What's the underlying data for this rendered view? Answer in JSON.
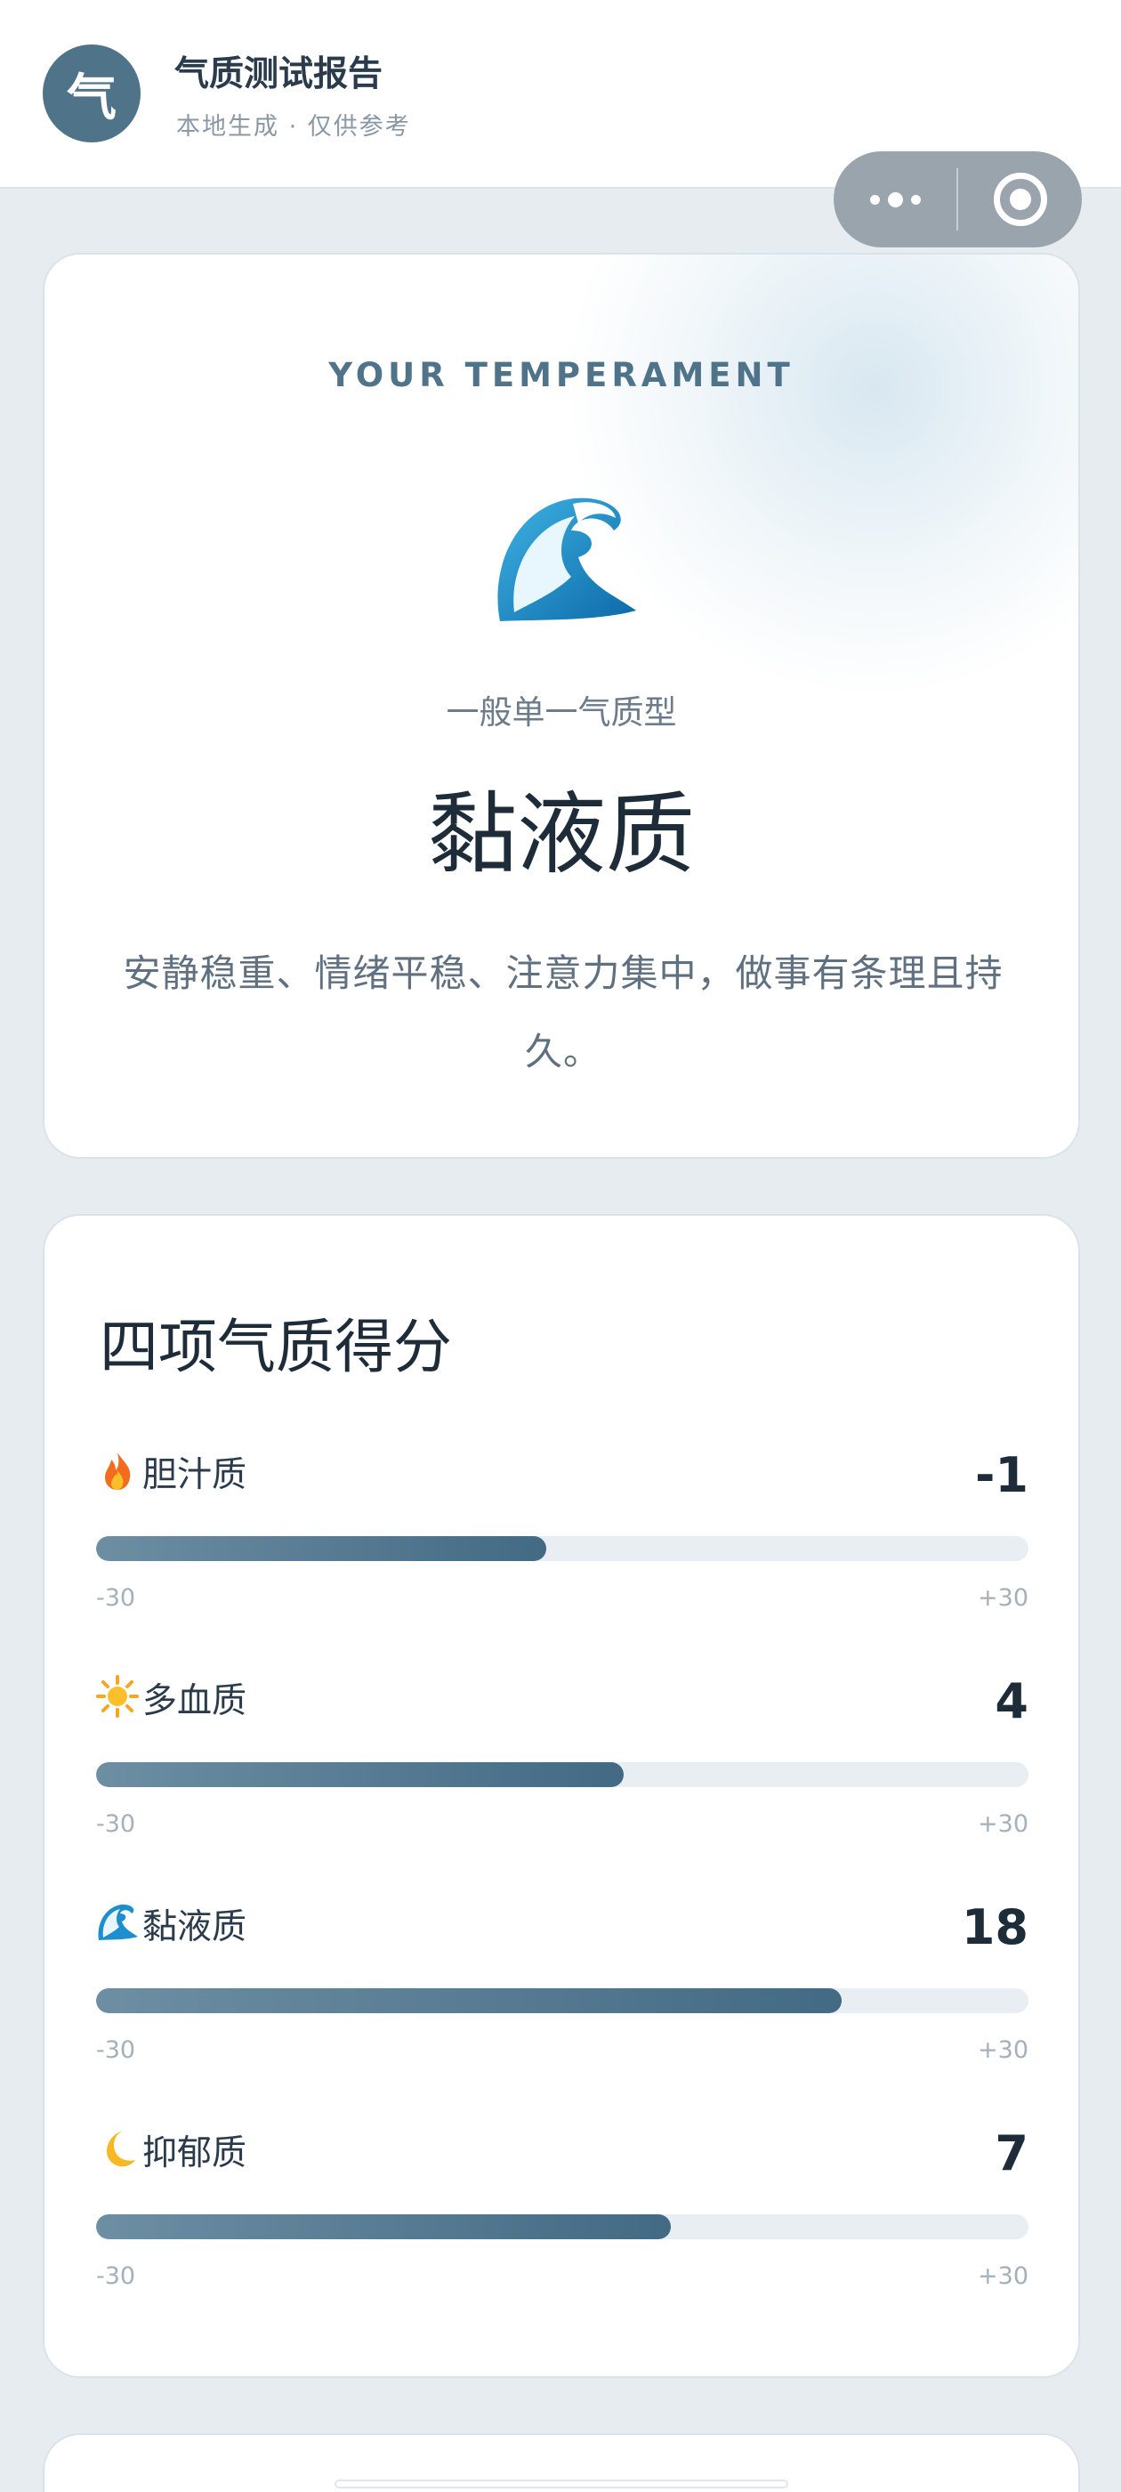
{
  "header": {
    "logo_char": "气",
    "title": "气质测试报告",
    "subtitle": "本地生成 · 仅供参考"
  },
  "capsule": {
    "more_icon": "more-dots-icon",
    "close_icon": "target-ring-icon"
  },
  "hero": {
    "eyebrow": "YOUR TEMPERAMENT",
    "icon": "wave-icon",
    "type_tag": "一般单一气质型",
    "type_name": "黏液质",
    "description": "安静稳重、情绪平稳、注意力集中，做事有条理且持久。"
  },
  "scores": {
    "title": "四项气质得分",
    "range_min": "-30",
    "range_max": "+30",
    "items": [
      {
        "icon": "fire-icon",
        "name": "胆汁质",
        "value": "-1",
        "fill_pct": 48.3
      },
      {
        "icon": "sun-icon",
        "name": "多血质",
        "value": "4",
        "fill_pct": 56.6
      },
      {
        "icon": "wave-icon",
        "name": "黏液质",
        "value": "18",
        "fill_pct": 80
      },
      {
        "icon": "moon-icon",
        "name": "抑郁质",
        "value": "7",
        "fill_pct": 61.6
      }
    ]
  },
  "colors": {
    "accent": "#4f7389",
    "bar_start": "#6d8ea3",
    "bar_end": "#436a84",
    "track": "#e8eef2"
  }
}
